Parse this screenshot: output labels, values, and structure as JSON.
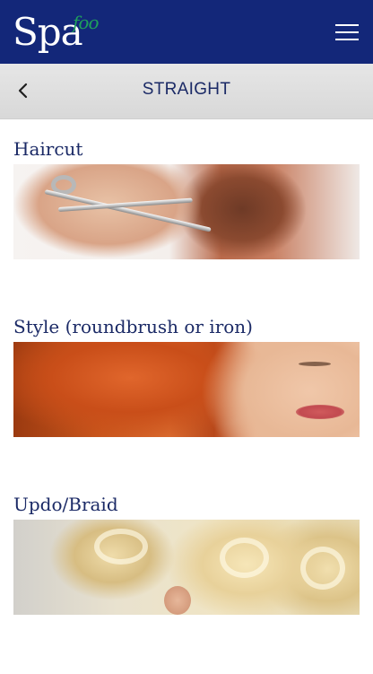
{
  "header": {
    "logo_main": "Spa",
    "logo_sub": "foo",
    "menu_icon": "hamburger-menu-icon",
    "colors": {
      "background": "#132779",
      "logo_accent": "#1fa05c"
    }
  },
  "titlebar": {
    "back_icon": "chevron-left-icon",
    "title": "STRAIGHT"
  },
  "services": [
    {
      "name": "Haircut",
      "image": "haircut-scissors-photo"
    },
    {
      "name": "Style (roundbrush or iron)",
      "image": "red-curled-hair-photo"
    },
    {
      "name": "Updo/Braid",
      "image": "blonde-updo-photo"
    }
  ]
}
